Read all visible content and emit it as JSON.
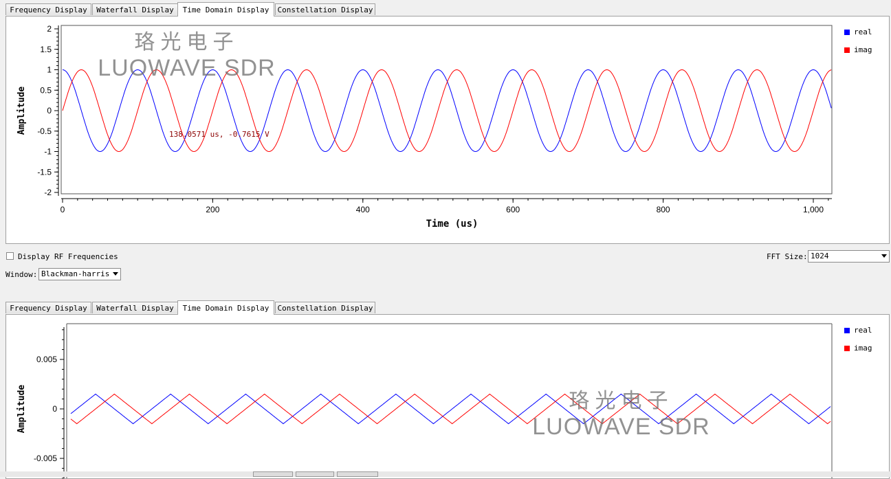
{
  "tabs": [
    "Frequency Display",
    "Waterfall Display",
    "Time Domain Display",
    "Constellation Display"
  ],
  "top_plot": {
    "ylabel": "Amplitude",
    "xlabel": "Time (us)",
    "yticks": [
      "2",
      "1.5",
      "1",
      "0.5",
      "0",
      "-0.5",
      "-1",
      "-1.5",
      "-2"
    ],
    "xticks": [
      "0",
      "200",
      "400",
      "600",
      "800",
      "1,000"
    ],
    "legend": [
      {
        "name": "real",
        "color": "#0000ff"
      },
      {
        "name": "imag",
        "color": "#ff0000"
      }
    ],
    "annotation": "138.0571 us, -0.7615 V",
    "watermark": {
      "cn": "珞光电子",
      "en": "LUOWAVE SDR"
    }
  },
  "controls": {
    "display_rf_label": "Display RF Frequencies",
    "fft_size_label": "FFT Size:",
    "fft_size_value": "1024",
    "window_label": "Window:",
    "window_value": "Blackman-harris"
  },
  "bottom_plot": {
    "ylabel": "Amplitude",
    "yticks": [
      "0.005",
      "0",
      "-0.005"
    ],
    "legend": [
      {
        "name": "real",
        "color": "#0000ff"
      },
      {
        "name": "imag",
        "color": "#ff0000"
      }
    ],
    "watermark": {
      "cn": "珞光电子",
      "en": "LUOWAVE SDR"
    }
  },
  "chart_data": [
    {
      "type": "line",
      "ylabel": "Amplitude",
      "xlabel": "Time (us)",
      "xlim": [
        0,
        1024
      ],
      "ylim": [
        -2,
        2
      ],
      "series": [
        {
          "name": "real",
          "color": "#0000ff",
          "function": "cos",
          "amplitude": 1,
          "period_us": 100,
          "phase_us": 0
        },
        {
          "name": "imag",
          "color": "#ff0000",
          "function": "sin",
          "amplitude": 1,
          "period_us": 100,
          "phase_us": 0
        }
      ]
    },
    {
      "type": "line",
      "ylabel": "Amplitude",
      "ylim": [
        -0.0085,
        0.0085
      ],
      "series": [
        {
          "name": "real",
          "color": "#0000ff",
          "function": "triangle",
          "amplitude": 0.0015,
          "period_us": 100
        },
        {
          "name": "imag",
          "color": "#ff0000",
          "function": "triangle",
          "amplitude": 0.0015,
          "period_us": 100
        }
      ]
    }
  ]
}
